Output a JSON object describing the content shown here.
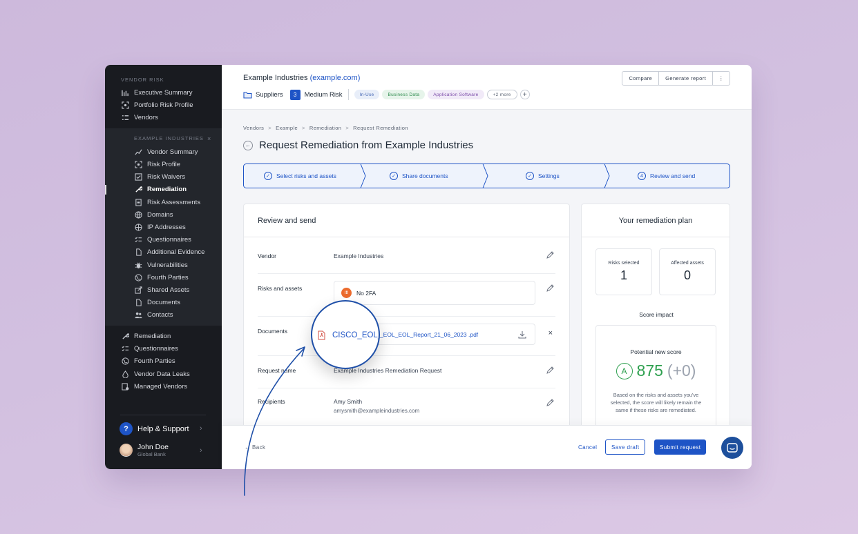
{
  "sidebar": {
    "section_main": "VENDOR RISK",
    "main_items": [
      {
        "label": "Executive Summary",
        "icon": "bar-chart-icon"
      },
      {
        "label": "Portfolio Risk Profile",
        "icon": "scan-icon"
      },
      {
        "label": "Vendors",
        "icon": "list-icon"
      }
    ],
    "section_sub": "EXAMPLE INDUSTRIES",
    "close": "×",
    "sub_items": [
      {
        "label": "Vendor Summary",
        "icon": "trend-icon"
      },
      {
        "label": "Risk Profile",
        "icon": "scan-icon"
      },
      {
        "label": "Risk Waivers",
        "icon": "checkbox-icon"
      },
      {
        "label": "Remediation",
        "icon": "wrench-icon"
      },
      {
        "label": "Risk Assessments",
        "icon": "document-icon"
      },
      {
        "label": "Domains",
        "icon": "globe-icon"
      },
      {
        "label": "IP Addresses",
        "icon": "ip-icon"
      },
      {
        "label": "Questionnaires",
        "icon": "checklist-icon"
      },
      {
        "label": "Additional Evidence",
        "icon": "file-icon"
      },
      {
        "label": "Vulnerabilities",
        "icon": "bug-icon"
      },
      {
        "label": "Fourth Parties",
        "icon": "globe-icon"
      },
      {
        "label": "Shared Assets",
        "icon": "share-icon"
      },
      {
        "label": "Documents",
        "icon": "file-icon"
      },
      {
        "label": "Contacts",
        "icon": "users-icon"
      }
    ],
    "bottom_items": [
      {
        "label": "Remediation",
        "icon": "wrench-icon"
      },
      {
        "label": "Questionnaires",
        "icon": "checklist-icon"
      },
      {
        "label": "Fourth Parties",
        "icon": "globe-icon"
      },
      {
        "label": "Vendor Data Leaks",
        "icon": "drop-icon"
      },
      {
        "label": "Managed Vendors",
        "icon": "managed-icon"
      }
    ],
    "help": {
      "icon_text": "?",
      "label": "Help & Support"
    },
    "user": {
      "name": "John Doe",
      "org": "Global Bank"
    }
  },
  "header": {
    "vendor_name": "Example Industries",
    "domain_open": "(",
    "domain": "example.com",
    "domain_close": ")",
    "portfolio": "Suppliers",
    "risk_level": "3",
    "risk_label": "Medium Risk",
    "tags": [
      "In-Use",
      "Business Data",
      "Application Software"
    ],
    "more_tags": "+2 more",
    "add_tag": "+",
    "buttons": {
      "compare": "Compare",
      "report": "Generate report",
      "more": "⋮"
    }
  },
  "breadcrumb": [
    "Vendors",
    "Example",
    "Remediation",
    "Request Remediation"
  ],
  "breadcrumb_sep": ">",
  "page_title": "Request Remediation from Example Industries",
  "steps": [
    {
      "label": "Select risks and assets",
      "marker": "✓"
    },
    {
      "label": "Share documents",
      "marker": "✓"
    },
    {
      "label": "Settings",
      "marker": "✓"
    },
    {
      "label": "Review and send",
      "marker": "4"
    }
  ],
  "review": {
    "title": "Review and send",
    "vendor_label": "Vendor",
    "vendor_value": "Example Industries",
    "risks_label": "Risks and assets",
    "risk_icon_text": "!!!",
    "risk_item": "No 2FA",
    "documents_label": "Documents",
    "document_file": "CISCO_EOL_EOL_Report_21_06_2023 .pdf",
    "remove": "×",
    "request_name_label": "Request name",
    "request_name_value": "Example Industries Remediation Request",
    "recipients_label": "Recipients",
    "recipient_name": "Amy Smith",
    "recipient_email": "amysmith@exampleindustries.com"
  },
  "plan": {
    "title": "Your remediation plan",
    "risks_selected_label": "Risks selected",
    "risks_selected": "1",
    "affected_assets_label": "Affected assets",
    "affected_assets": "0",
    "score_impact": "Score impact",
    "potential_label": "Potential new score",
    "grade": "A",
    "score": "875",
    "delta": "(+0)",
    "description": "Based on the risks and assets you've selected, the score will likely remain the same if these risks are remediated."
  },
  "footer": {
    "back": "← Back",
    "cancel": "Cancel",
    "save_draft": "Save draft",
    "submit": "Submit request"
  },
  "magnifier_text": "CISCO_EOL_",
  "colors": {
    "accent": "#1e54c6",
    "sidebar": "#191b20",
    "score_green": "#2ea04f",
    "risk_orange": "#ec6b2d"
  }
}
